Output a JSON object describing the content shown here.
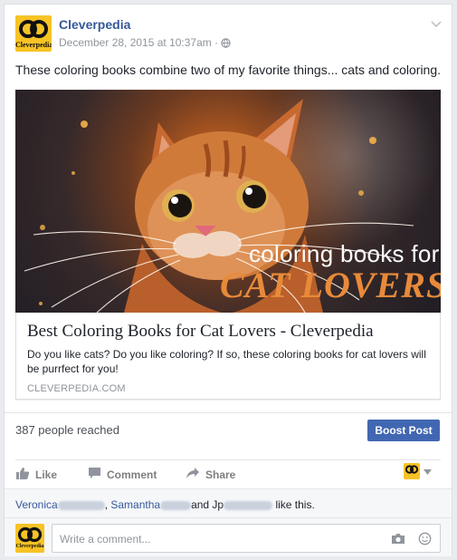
{
  "post": {
    "page_name": "Cleverpedia",
    "timestamp": "December 28, 2015 at 10:37am",
    "privacy_separator": "·",
    "text": "These coloring books combine two of my favorite things... cats and coloring.",
    "logo_text": "Cleverpedia"
  },
  "link": {
    "image_line1": "coloring books for",
    "image_line2": "CAT LOVERS",
    "title": "Best Coloring Books for Cat Lovers - Cleverpedia",
    "description": "Do you like cats? Do you like coloring? If so, these coloring books for cat lovers will be purrfect for you!",
    "domain": "CLEVERPEDIA.COM"
  },
  "insights": {
    "reach": "387 people reached",
    "boost_label": "Boost Post"
  },
  "actions": {
    "like": "Like",
    "comment": "Comment",
    "share": "Share"
  },
  "likes": {
    "name1": "Veronica",
    "name2": "Samantha",
    "and_text": "and Jp",
    "suffix": "like this."
  },
  "comment": {
    "placeholder": "Write a comment..."
  },
  "colors": {
    "brand_blue": "#365899",
    "button_blue": "#4267b2",
    "logo_yellow": "#f7c325",
    "cat_text_orange": "#e88a3a"
  }
}
